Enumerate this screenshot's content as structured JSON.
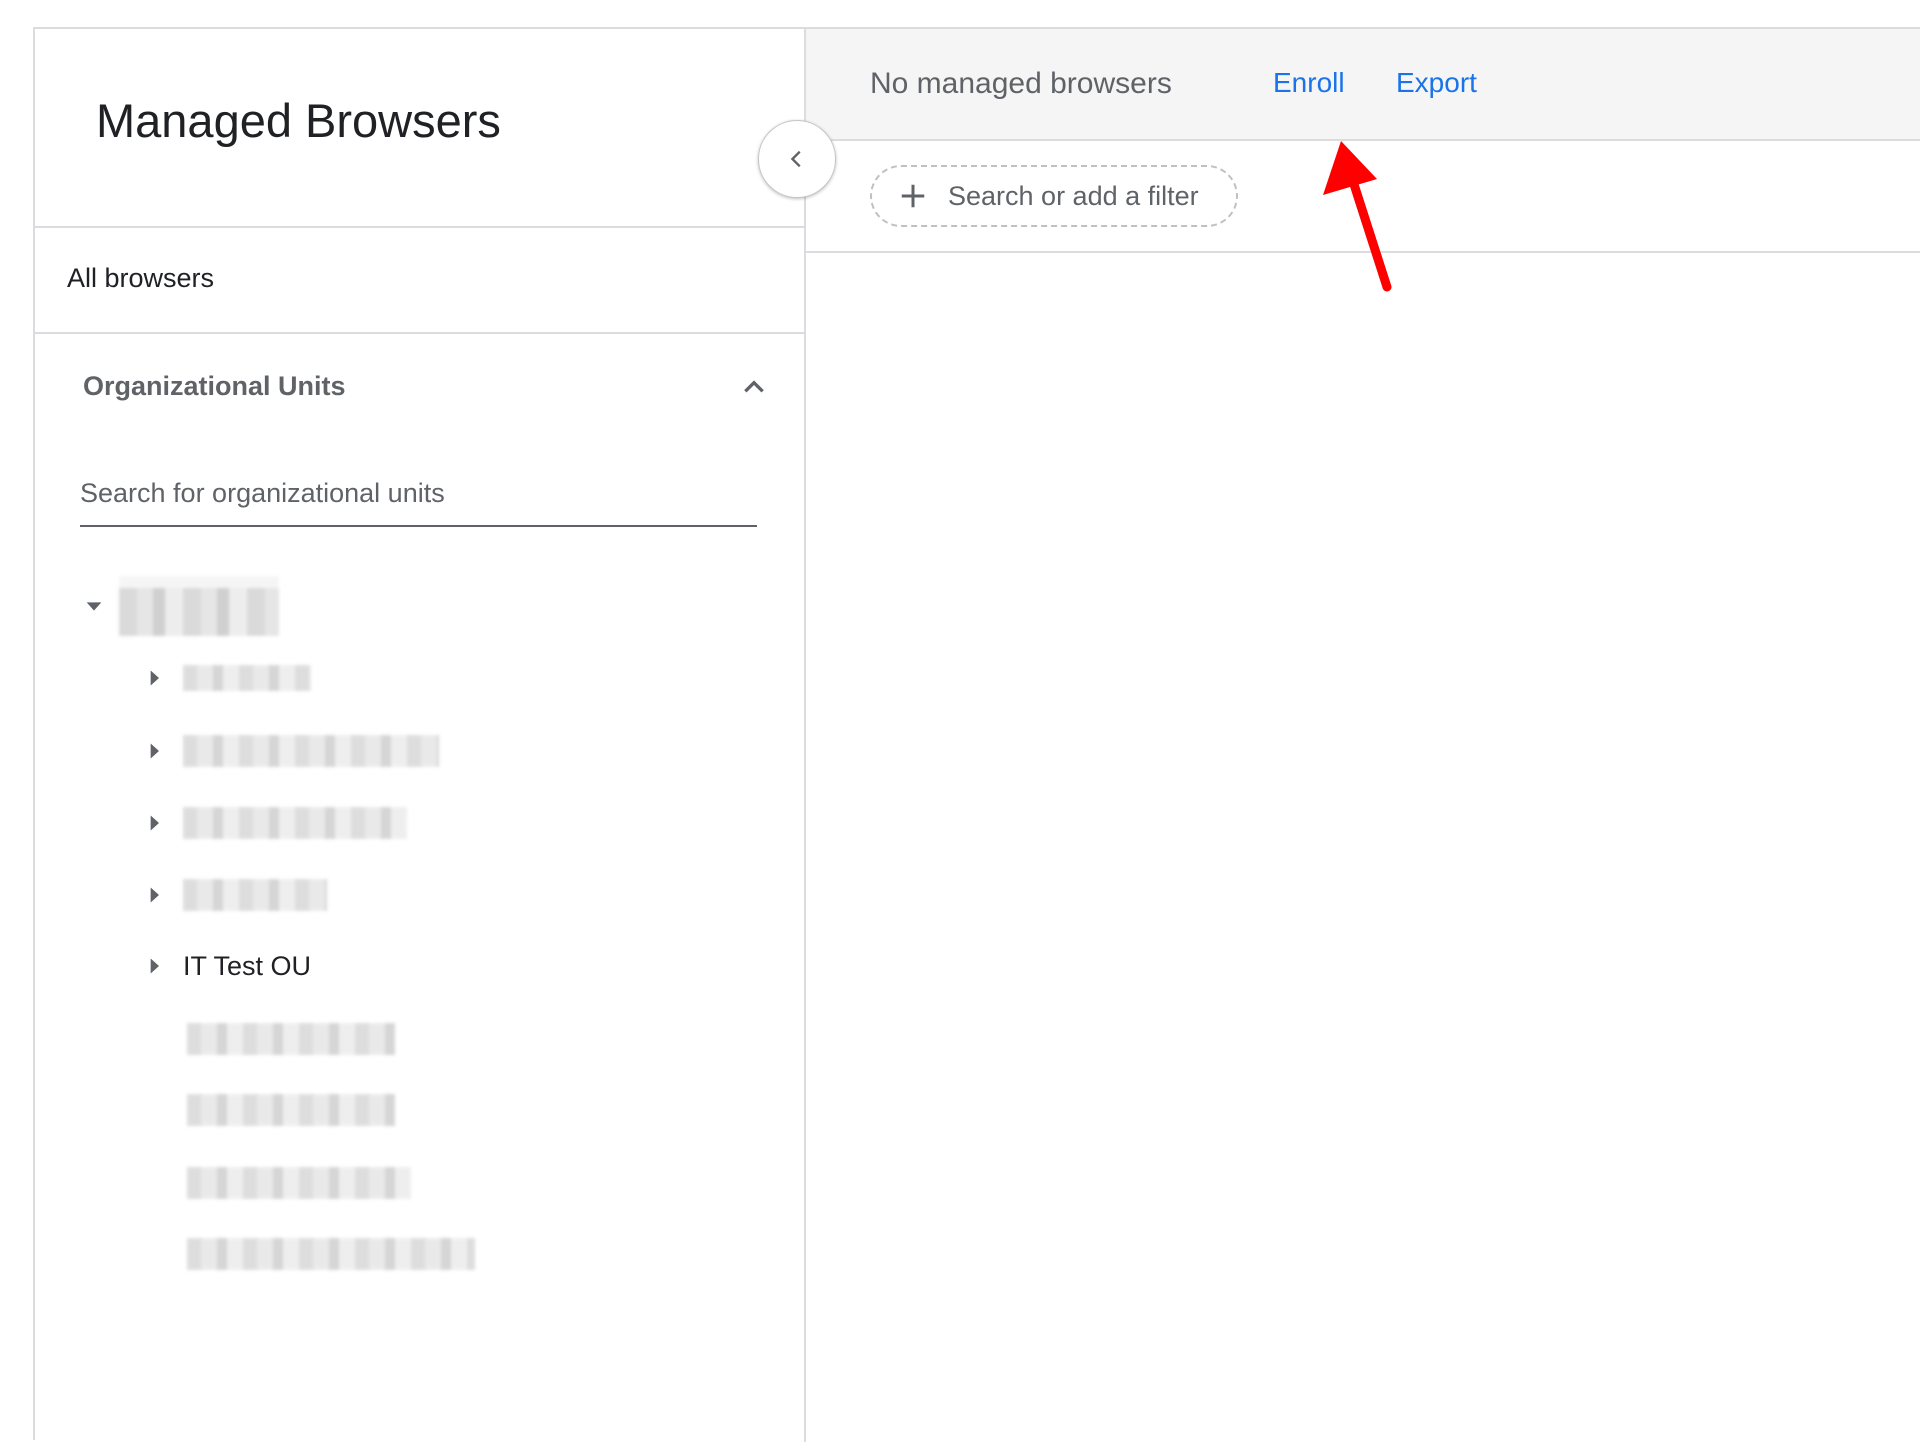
{
  "sidebar": {
    "title": "Managed Browsers",
    "all_browsers_label": "All browsers",
    "org_units": {
      "title": "Organizational Units",
      "search_placeholder": "Search for organizational units",
      "tree": {
        "root": {
          "label": "",
          "expanded": true
        },
        "children": [
          {
            "label": "",
            "redacted": true
          },
          {
            "label": "",
            "redacted": true
          },
          {
            "label": "",
            "redacted": true
          },
          {
            "label": "",
            "redacted": true
          },
          {
            "label": "IT Test OU",
            "redacted": false
          }
        ],
        "leaves": [
          {
            "label": "",
            "redacted": true
          },
          {
            "label": "",
            "redacted": true
          },
          {
            "label": "",
            "redacted": true
          },
          {
            "label": "",
            "redacted": true
          }
        ]
      }
    }
  },
  "main": {
    "status_text": "No managed browsers",
    "enroll_label": "Enroll",
    "export_label": "Export",
    "filter_placeholder": "Search or add a filter"
  },
  "icons": {
    "collapse": "chevron-left-icon",
    "section_toggle": "chevron-up-icon",
    "tree_expanded": "caret-down-icon",
    "tree_collapsed": "caret-right-icon",
    "add_filter": "plus-icon",
    "annotation": "red-arrow-icon"
  },
  "colors": {
    "link": "#1a73e8",
    "toolbar_bg": "#f5f5f5",
    "annotation": "#ff0000",
    "divider": "#dadce0"
  }
}
